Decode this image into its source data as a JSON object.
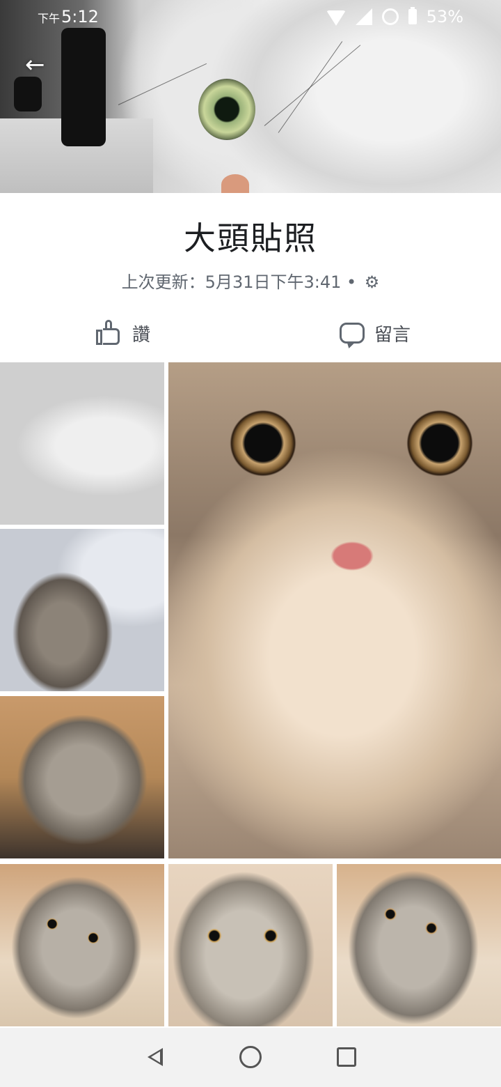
{
  "status_bar": {
    "ampm": "下午",
    "time": "5:12",
    "battery": "53%",
    "icons": [
      "wifi-icon",
      "signal-icon",
      "alarm-icon",
      "battery-icon"
    ]
  },
  "header": {
    "back_icon": "arrow-left-icon"
  },
  "album": {
    "title": "大頭貼照",
    "updated": "上次更新：5月31日下午3:41",
    "separator": " • ",
    "privacy_icon": "gear-icon"
  },
  "actions": {
    "like_label": "讚",
    "comment_label": "留言"
  },
  "photos": [
    {
      "id": "photo-1",
      "subject": "cat lying on floor"
    },
    {
      "id": "photo-2",
      "subject": "tabby cat looking up"
    },
    {
      "id": "photo-3",
      "subject": "cat sitting"
    },
    {
      "id": "photo-4",
      "subject": "cat face close-up"
    },
    {
      "id": "photo-5",
      "subject": "cat portrait"
    },
    {
      "id": "photo-6",
      "subject": "cat portrait"
    },
    {
      "id": "photo-7",
      "subject": "cat portrait"
    }
  ],
  "navbar": {
    "icons": [
      "back-triangle-icon",
      "home-circle-icon",
      "recents-square-icon"
    ]
  }
}
